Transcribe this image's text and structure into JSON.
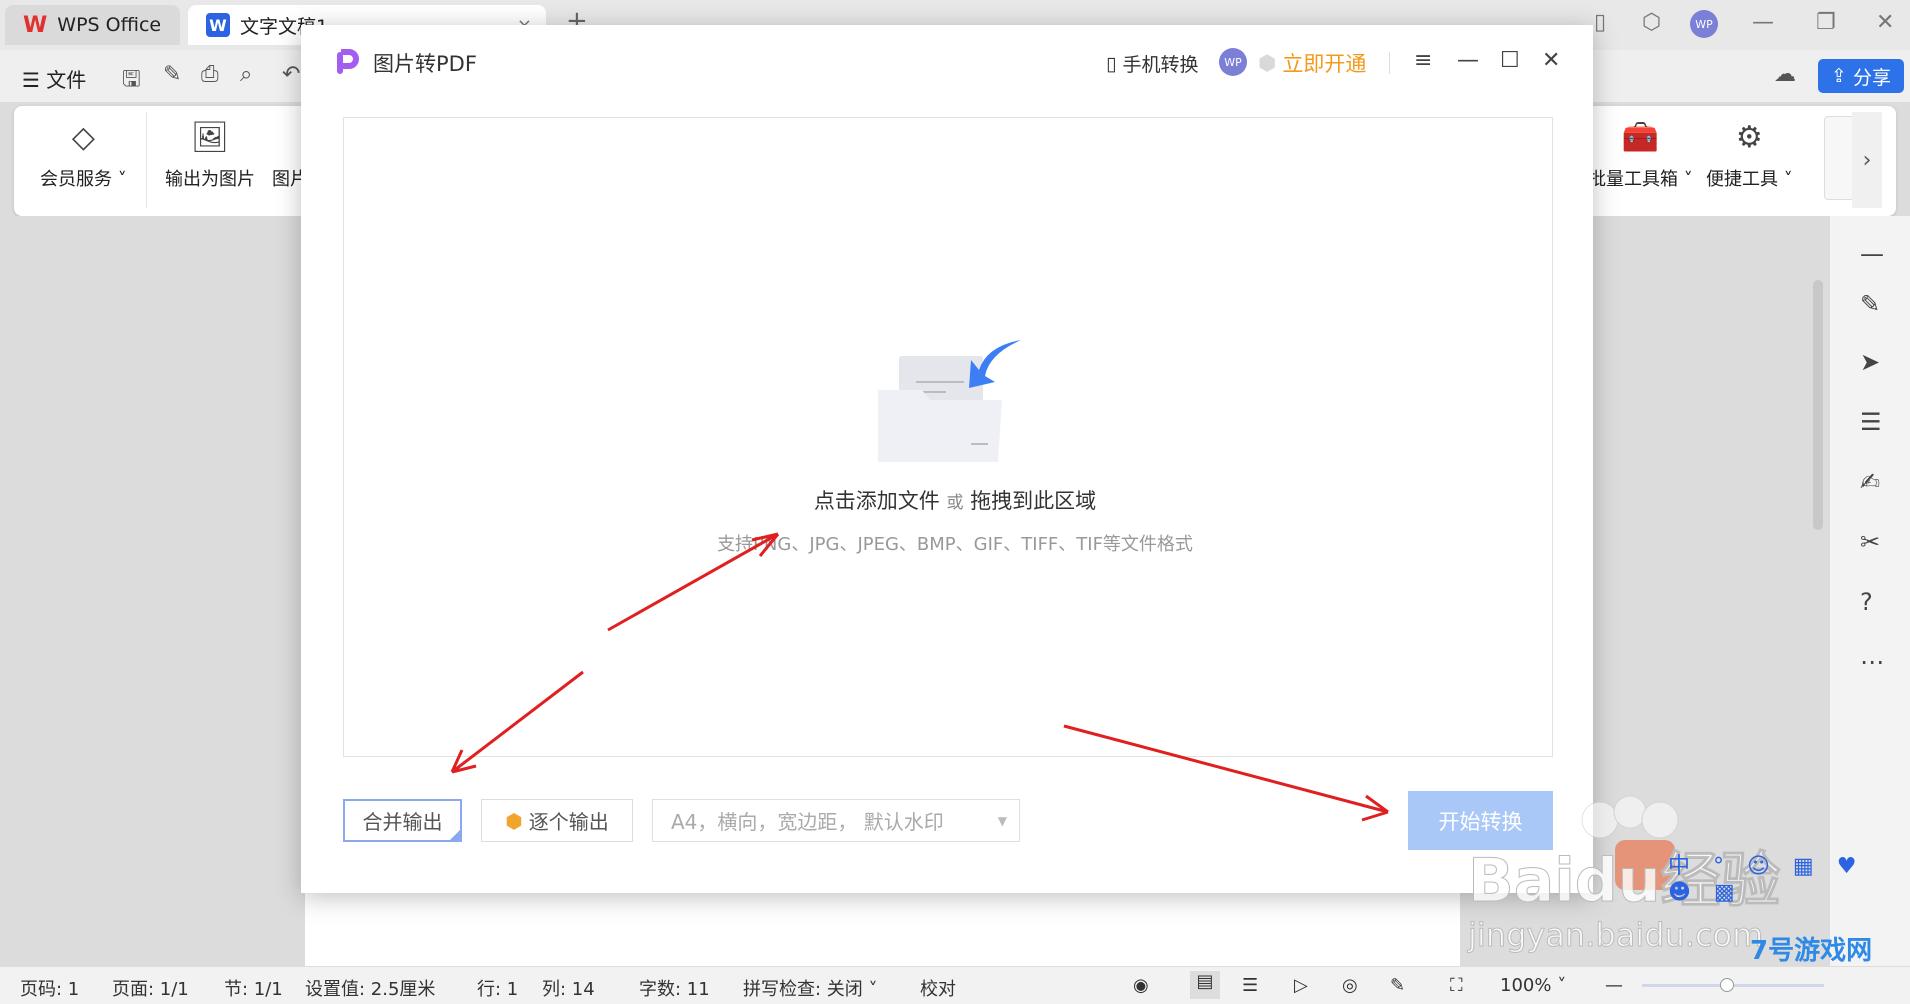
{
  "tabs": {
    "home": "WPS Office",
    "doc": "文字文稿1"
  },
  "titlebar": {
    "avatar": "WP"
  },
  "menu": {
    "file": "文件",
    "share": "分享"
  },
  "ribbon": {
    "items": [
      {
        "label": "会员服务",
        "icon": "diamond-icon"
      },
      {
        "label": "输出为图片",
        "icon": "image-export-icon"
      },
      {
        "label": "图片",
        "icon": "image-icon"
      },
      {
        "label": "批量工具箱",
        "icon": "toolbox-icon"
      },
      {
        "label": "便捷工具",
        "icon": "tools-icon"
      }
    ]
  },
  "dialog": {
    "title": "图片转PDF",
    "phone": "手机转换",
    "avatar": "WP",
    "vip": "立即开通",
    "drop_main": "点击添加文件",
    "drop_or": "或",
    "drop_main2": "拖拽到此区域",
    "drop_sub": "支持PNG、JPG、JPEG、BMP、GIF、TIFF、TIF等文件格式",
    "merge": "合并输出",
    "each": "逐个输出",
    "page_setting": "A4，横向，宽边距， 默认水印",
    "start": "开始转换"
  },
  "status": {
    "page": "页码: 1",
    "pages": "页面: 1/1",
    "section": "节: 1/1",
    "setting": "设置值: 2.5厘米",
    "row": "行: 1",
    "col": "列: 14",
    "words": "字数: 11",
    "spell": "拼写检查: 关闭",
    "proof": "校对",
    "zoom": "100%"
  },
  "watermark": {
    "text1": "Baidu经验",
    "text2": "jingyan.baidu.com",
    "text3": "7号游戏网"
  }
}
